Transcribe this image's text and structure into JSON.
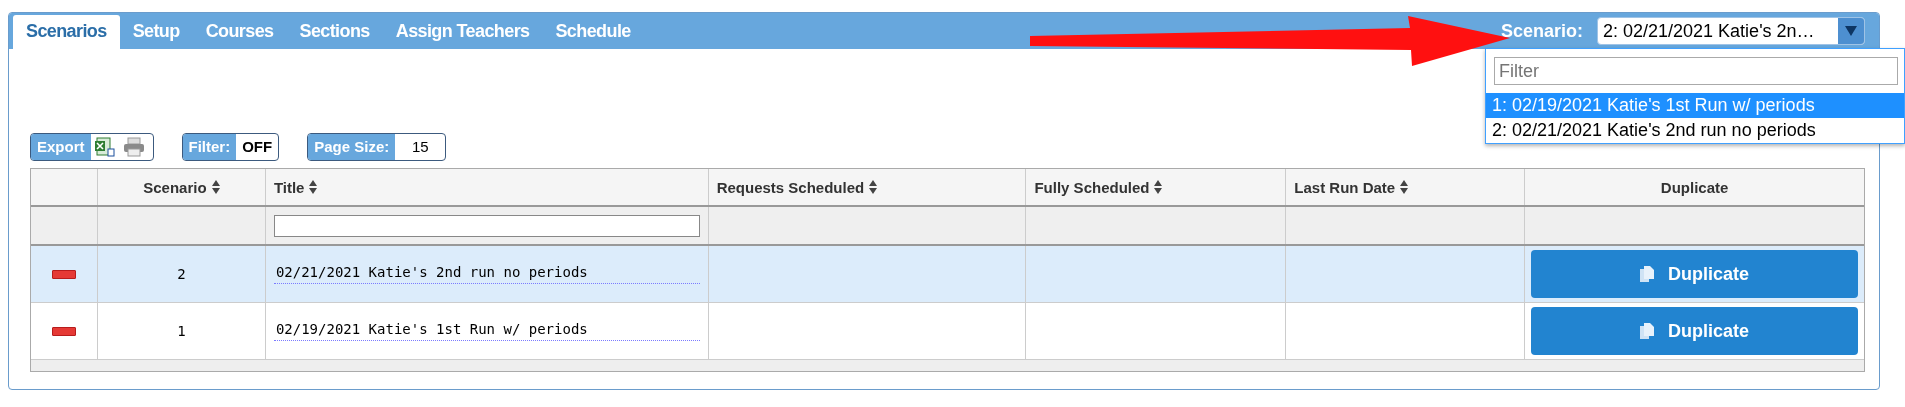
{
  "tabs": [
    {
      "label": "Scenarios",
      "selected": true
    },
    {
      "label": "Setup",
      "selected": false
    },
    {
      "label": "Courses",
      "selected": false
    },
    {
      "label": "Sections",
      "selected": false
    },
    {
      "label": "Assign Teachers",
      "selected": false
    },
    {
      "label": "Schedule",
      "selected": false
    }
  ],
  "scenario_picker": {
    "label": "Scenario:",
    "value": "2: 02/21/2021 Katie's 2n…"
  },
  "dropdown": {
    "placeholder": "Filter",
    "options": [
      {
        "label": "1: 02/19/2021 Katie's 1st Run w/ periods",
        "selected": true
      },
      {
        "label": "2: 02/21/2021 Katie's 2nd run no periods",
        "selected": false
      }
    ]
  },
  "toolbar": {
    "export_label": "Export",
    "filter_label": "Filter:",
    "filter_value": "OFF",
    "page_size_label": "Page Size:",
    "page_size_value": "15"
  },
  "table": {
    "columns": [
      {
        "label": "Scenario",
        "sortable": true
      },
      {
        "label": "Title",
        "sortable": true
      },
      {
        "label": "Requests Scheduled",
        "sortable": true
      },
      {
        "label": "Fully Scheduled",
        "sortable": true
      },
      {
        "label": "Last Run Date",
        "sortable": true
      },
      {
        "label": "Duplicate",
        "sortable": false
      }
    ],
    "rows": [
      {
        "scenario": "2",
        "title": "02/21/2021 Katie's 2nd run no periods",
        "selected": true,
        "action": "Duplicate"
      },
      {
        "scenario": "1",
        "title": "02/19/2021 Katie's 1st Run w/ periods",
        "selected": false,
        "action": "Duplicate"
      }
    ]
  }
}
